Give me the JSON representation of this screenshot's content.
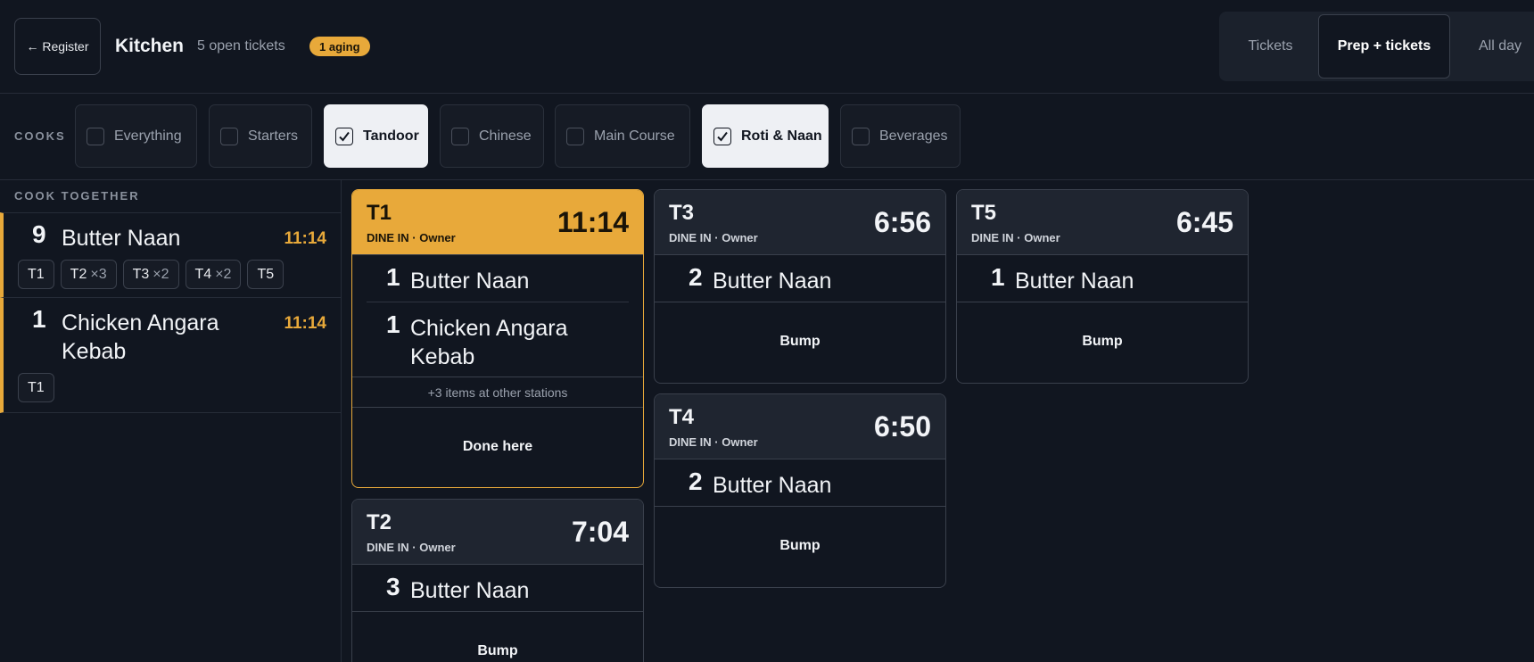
{
  "header": {
    "register_label": "← Register",
    "title": "Kitchen",
    "open_tickets": "5 open tickets",
    "aging_badge": "1 aging",
    "view_tabs": [
      "Tickets",
      "Prep + tickets",
      "All day"
    ]
  },
  "stations": {
    "label": "COOKS",
    "chips": [
      {
        "label": "Everything",
        "checked": false
      },
      {
        "label": "Starters",
        "checked": false
      },
      {
        "label": "Tandoor",
        "checked": true
      },
      {
        "label": "Chinese",
        "checked": false
      },
      {
        "label": "Main Course",
        "checked": false
      },
      {
        "label": "Roti & Naan",
        "checked": true
      },
      {
        "label": "Beverages",
        "checked": false
      }
    ]
  },
  "sidebar": {
    "heading": "COOK TOGETHER",
    "items": [
      {
        "qty": "9",
        "name": "Butter Naan",
        "time": "11:14",
        "tags": [
          {
            "id": "T1",
            "mult": ""
          },
          {
            "id": "T2",
            "mult": "×3"
          },
          {
            "id": "T3",
            "mult": "×2"
          },
          {
            "id": "T4",
            "mult": "×2"
          },
          {
            "id": "T5",
            "mult": ""
          }
        ]
      },
      {
        "qty": "1",
        "name": "Chicken Angara Kebab",
        "time": "11:14",
        "tags": [
          {
            "id": "T1",
            "mult": ""
          }
        ]
      }
    ]
  },
  "tickets": {
    "t1": {
      "id": "T1",
      "sub": "DINE IN · Owner",
      "time": "11:14",
      "items": [
        {
          "qty": "1",
          "name": "Butter Naan"
        },
        {
          "qty": "1",
          "name": "Chicken Angara Kebab"
        }
      ],
      "note": "+3 items at other stations",
      "action": "Done here"
    },
    "t2": {
      "id": "T2",
      "sub": "DINE IN · Owner",
      "time": "7:04",
      "items": [
        {
          "qty": "3",
          "name": "Butter Naan"
        }
      ],
      "action": "Bump"
    },
    "t3": {
      "id": "T3",
      "sub": "DINE IN · Owner",
      "time": "6:56",
      "items": [
        {
          "qty": "2",
          "name": "Butter Naan"
        }
      ],
      "action": "Bump"
    },
    "t4": {
      "id": "T4",
      "sub": "DINE IN · Owner",
      "time": "6:50",
      "items": [
        {
          "qty": "2",
          "name": "Butter Naan"
        }
      ],
      "action": "Bump"
    },
    "t5": {
      "id": "T5",
      "sub": "DINE IN · Owner",
      "time": "6:45",
      "items": [
        {
          "qty": "1",
          "name": "Butter Naan"
        }
      ],
      "action": "Bump"
    }
  },
  "colors": {
    "accent": "#e8a93a",
    "background": "#111620",
    "chip_active": "#eef0f4"
  },
  "icons": {
    "checkbox": "checkmark-icon"
  }
}
